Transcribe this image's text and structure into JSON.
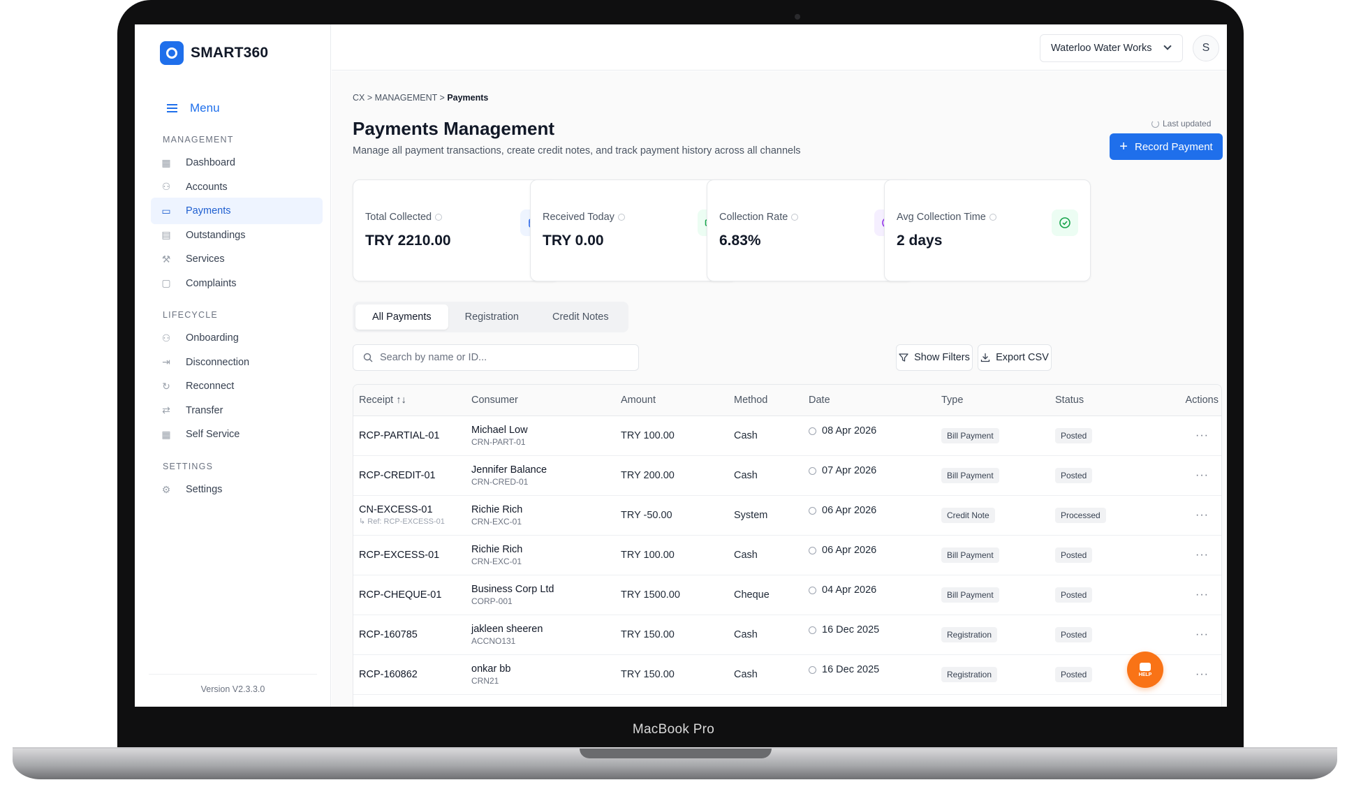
{
  "device": {
    "label": "MacBook Pro"
  },
  "brand": {
    "name": "SMART360",
    "accent": "#1f6feb"
  },
  "sidebar": {
    "menu_label": "Menu",
    "sections": [
      {
        "title": "MANAGEMENT",
        "items": [
          {
            "label": "Dashboard",
            "icon": "grid-icon"
          },
          {
            "label": "Accounts",
            "icon": "users-icon"
          },
          {
            "label": "Payments",
            "icon": "card-icon",
            "active": true
          },
          {
            "label": "Outstandings",
            "icon": "document-icon"
          },
          {
            "label": "Services",
            "icon": "wrench-icon"
          },
          {
            "label": "Complaints",
            "icon": "chat-icon"
          }
        ]
      },
      {
        "title": "LIFECYCLE",
        "items": [
          {
            "label": "Onboarding",
            "icon": "user-plus-icon"
          },
          {
            "label": "Disconnection",
            "icon": "logout-icon"
          },
          {
            "label": "Reconnect",
            "icon": "refresh-icon"
          },
          {
            "label": "Transfer",
            "icon": "swap-icon"
          },
          {
            "label": "Self Service",
            "icon": "grid-icon"
          }
        ]
      },
      {
        "title": "SETTINGS",
        "items": [
          {
            "label": "Settings",
            "icon": "gear-icon"
          }
        ]
      }
    ],
    "version": "Version V2.3.3.0"
  },
  "header": {
    "org": "Waterloo Water Works",
    "avatar_initial": "S"
  },
  "breadcrumb": {
    "part1": "CX",
    "sep": ">",
    "part2": "MANAGEMENT",
    "current": "Payments"
  },
  "page": {
    "title": "Payments Management",
    "subtitle": "Manage all payment transactions, create credit notes, and track payment history across all channels",
    "last_updated": "Last updated",
    "record_button": "Record Payment"
  },
  "stats": [
    {
      "label": "Total Collected",
      "value": "TRY 2210.00",
      "icon": "calendar-icon",
      "color": "#2563eb",
      "bg": "#eef4ff"
    },
    {
      "label": "Received Today",
      "value": "TRY 0.00",
      "icon": "cash-icon",
      "color": "#16a34a",
      "bg": "#ecfdf3"
    },
    {
      "label": "Collection Rate",
      "value": "6.83%",
      "icon": "clock-icon",
      "color": "#9333ea",
      "bg": "#f5efff"
    },
    {
      "label": "Avg Collection Time",
      "value": "2 days",
      "icon": "check-circle-icon",
      "color": "#16a34a",
      "bg": "#ecfdf3"
    }
  ],
  "tabs": [
    "All Payments",
    "Registration",
    "Credit Notes"
  ],
  "search": {
    "placeholder": "Search by name or ID..."
  },
  "toolbar": {
    "filters": "Show Filters",
    "export": "Export CSV"
  },
  "table": {
    "headers": [
      "Receipt ↑↓",
      "Consumer",
      "Amount",
      "Method",
      "Date",
      "Type",
      "Status",
      "Actions"
    ],
    "rows": [
      {
        "receipt": "RCP-PARTIAL-01",
        "ref": "",
        "name": "Michael Low",
        "crn": "CRN-PART-01",
        "amount": "TRY 100.00",
        "method": "Cash",
        "date": "08 Apr 2026",
        "type": "Bill Payment",
        "status": "Posted"
      },
      {
        "receipt": "RCP-CREDIT-01",
        "ref": "",
        "name": "Jennifer Balance",
        "crn": "CRN-CRED-01",
        "amount": "TRY 200.00",
        "method": "Cash",
        "date": "07 Apr 2026",
        "type": "Bill Payment",
        "status": "Posted"
      },
      {
        "receipt": "CN-EXCESS-01",
        "ref": "↳ Ref: RCP-EXCESS-01",
        "name": "Richie Rich",
        "crn": "CRN-EXC-01",
        "amount": "TRY -50.00",
        "method": "System",
        "date": "06 Apr 2026",
        "type": "Credit Note",
        "status": "Processed"
      },
      {
        "receipt": "RCP-EXCESS-01",
        "ref": "",
        "name": "Richie Rich",
        "crn": "CRN-EXC-01",
        "amount": "TRY 100.00",
        "method": "Cash",
        "date": "06 Apr 2026",
        "type": "Bill Payment",
        "status": "Posted"
      },
      {
        "receipt": "RCP-CHEQUE-01",
        "ref": "",
        "name": "Business Corp Ltd",
        "crn": "CORP-001",
        "amount": "TRY 1500.00",
        "method": "Cheque",
        "date": "04 Apr 2026",
        "type": "Bill Payment",
        "status": "Posted"
      },
      {
        "receipt": "RCP-160785",
        "ref": "",
        "name": "jakleen sheeren",
        "crn": "ACCNO131",
        "amount": "TRY 150.00",
        "method": "Cash",
        "date": "16 Dec 2025",
        "type": "Registration",
        "status": "Posted"
      },
      {
        "receipt": "RCP-160862",
        "ref": "",
        "name": "onkar bb",
        "crn": "CRN21",
        "amount": "TRY 150.00",
        "method": "Cash",
        "date": "16 Dec 2025",
        "type": "Registration",
        "status": "Posted"
      }
    ],
    "actions_glyph": "···"
  },
  "help": {
    "label": "HELP",
    "color": "#f97316"
  }
}
